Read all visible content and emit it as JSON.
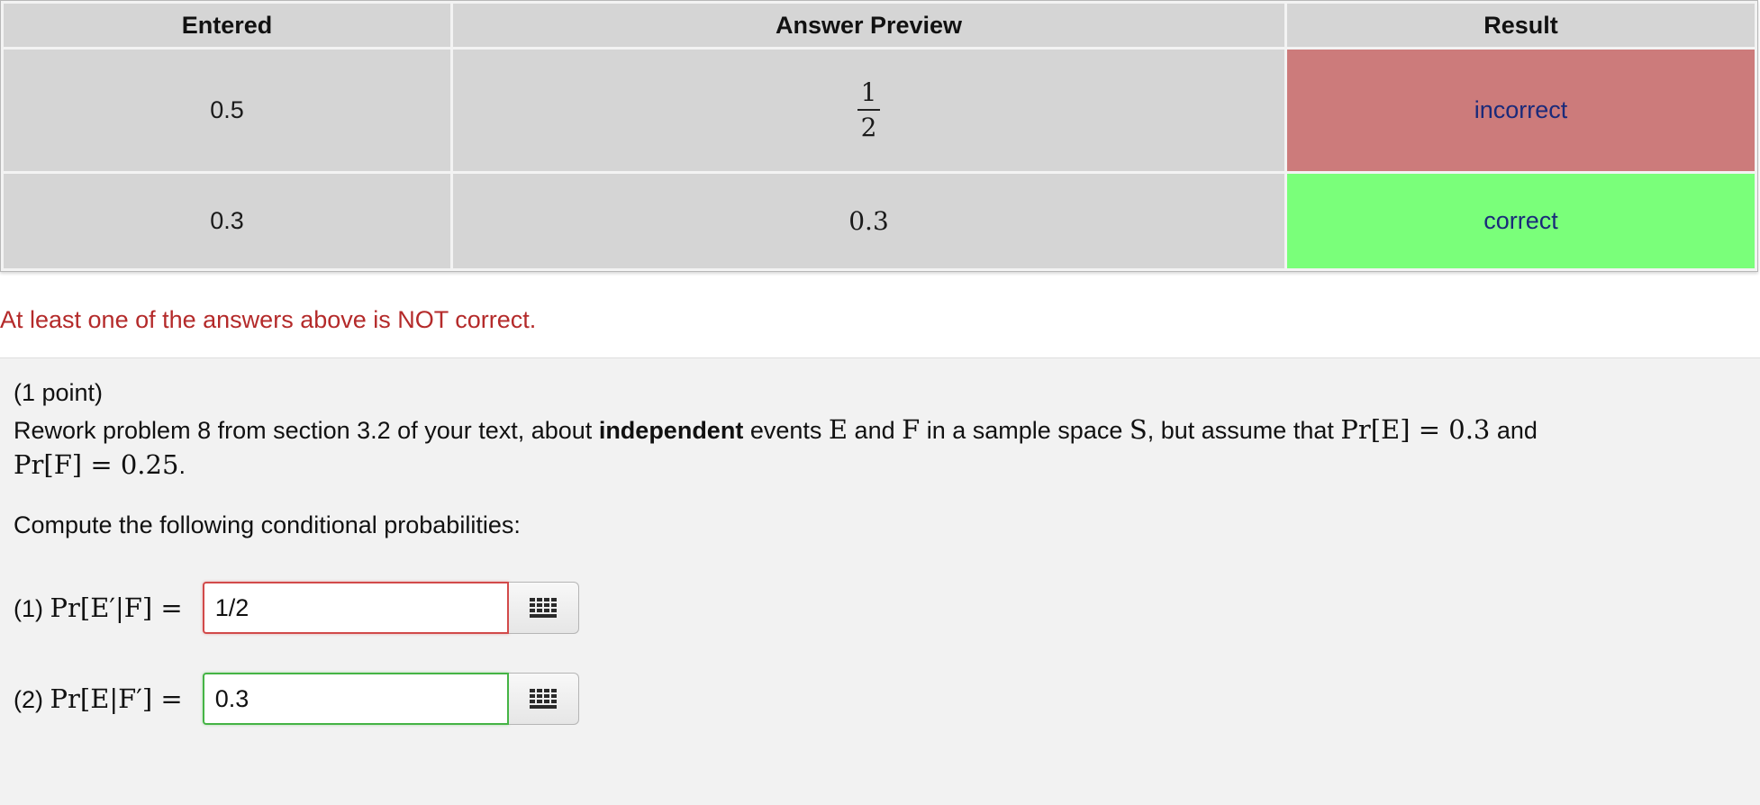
{
  "results_table": {
    "headers": {
      "entered": "Entered",
      "preview": "Answer Preview",
      "result": "Result"
    },
    "rows": [
      {
        "entered": "0.5",
        "preview_numerator": "1",
        "preview_denominator": "2",
        "result": "incorrect",
        "result_color": "#cc7b7b"
      },
      {
        "entered": "0.3",
        "preview": "0.3",
        "result": "correct",
        "result_color": "#7aff7a"
      }
    ]
  },
  "warning": {
    "text": "At least one of the answers above is NOT correct.",
    "color": "#b42a2a"
  },
  "problem": {
    "points": "(1 point)",
    "line1": {
      "prefix": "Rework problem 8 from section 3.2 of your text, about ",
      "bold": "independent",
      "middle1": " events ",
      "event_e": "E",
      "and1": " and ",
      "event_f": "F",
      "middle2": " in a sample space ",
      "space_s": "S",
      "middle3": ", but assume that ",
      "pr_e": "Pr[E] = 0.3",
      "and2": " and"
    },
    "line2": {
      "pr_f": "Pr[F] = 0.25",
      "period": "."
    },
    "instruction": "Compute the following conditional probabilities:",
    "answers": [
      {
        "number": "(1)",
        "expression": "Pr[E′|F] =",
        "value": "1/2",
        "status": "incorrect"
      },
      {
        "number": "(2)",
        "expression": "Pr[E|F′] =",
        "value": "0.3",
        "status": "correct"
      }
    ]
  },
  "icons": {
    "keypad": "keypad-grid-icon"
  }
}
